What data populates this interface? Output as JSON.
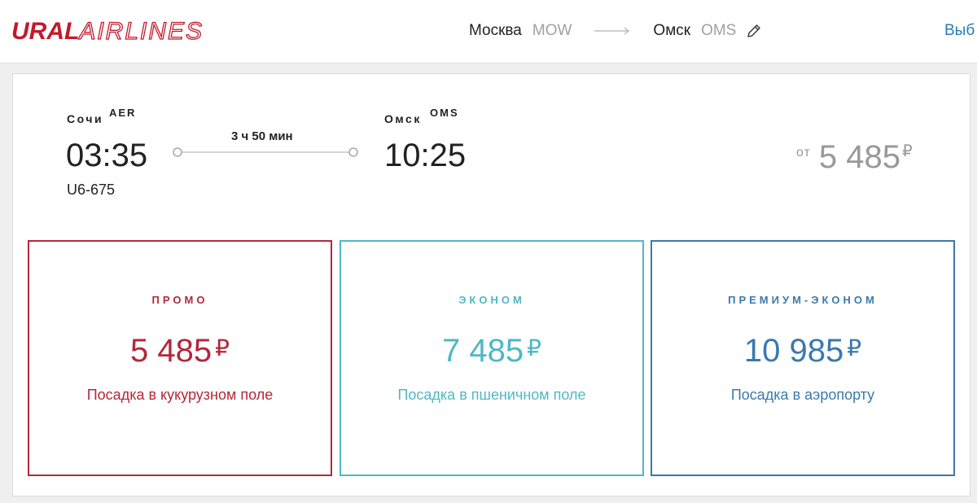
{
  "header": {
    "logo_bold": "URAL",
    "logo_thin": "AIRLINES",
    "route": {
      "from_city": "Москва",
      "from_code": "MOW",
      "to_city": "Омск",
      "to_code": "OMS"
    },
    "select_label": "Выб"
  },
  "flight": {
    "departure": {
      "city": "Сочи",
      "code": "AER",
      "time": "03:35"
    },
    "arrival": {
      "city": "Омск",
      "code": "OMS",
      "time": "10:25"
    },
    "duration": "3 ч 50 мин",
    "flight_number": "U6-675",
    "from_label": "от",
    "from_price": "5 485",
    "currency": "₽"
  },
  "fares": [
    {
      "name": "ПРОМО",
      "price": "5 485",
      "currency": "₽",
      "description": "Посадка в кукурузном поле",
      "color": "#b3283a"
    },
    {
      "name": "ЭКОНОМ",
      "price": "7 485",
      "currency": "₽",
      "description": "Посадка в пшеничном поле",
      "color": "#4fb8c4"
    },
    {
      "name": "ПРЕМИУМ-ЭКОНОМ",
      "price": "10 985",
      "currency": "₽",
      "description": "Посадка в аэропорту",
      "color": "#3b79ad"
    }
  ]
}
